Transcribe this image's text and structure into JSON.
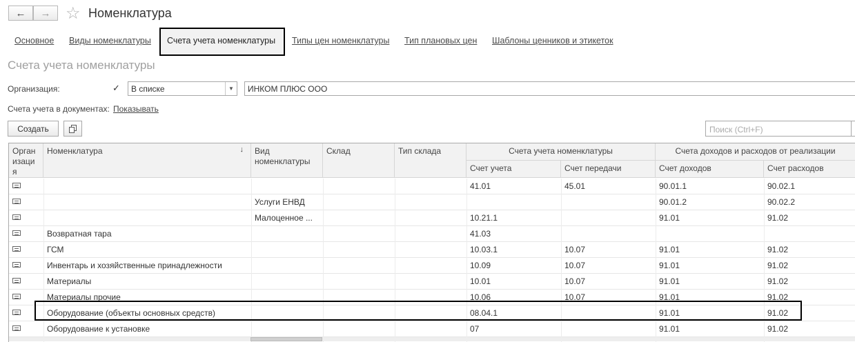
{
  "header": {
    "back_icon": "arrow-left-icon",
    "forward_icon": "arrow-right-icon",
    "favorite_icon": "star-icon",
    "title": "Номенклатура"
  },
  "tabs": [
    {
      "label": "Основное",
      "active": false
    },
    {
      "label": "Виды номенклатуры",
      "active": false
    },
    {
      "label": "Счета учета номенклатуры",
      "active": true
    },
    {
      "label": "Типы цен номенклатуры",
      "active": false
    },
    {
      "label": "Тип плановых цен",
      "active": false
    },
    {
      "label": "Шаблоны ценников и этикеток",
      "active": false
    }
  ],
  "section_title": "Счета учета номенклатуры",
  "filters": {
    "organization_label": "Организация:",
    "organization_checked": true,
    "mode_value": "В списке",
    "organization_value": "ИНКОМ ПЛЮС ООО",
    "docs_label": "Счета учета в документах:",
    "docs_link": "Показывать"
  },
  "toolbar": {
    "create_label": "Создать",
    "copy_icon": "copy-icon",
    "search_placeholder": "Поиск (Ctrl+F)"
  },
  "table": {
    "columns": {
      "org": "Орган изаци я",
      "nomenclature": "Номенклатура",
      "sort_icon": "↓",
      "kind": "Вид номенклатуры",
      "warehouse": "Склад",
      "warehouse_type": "Тип склада",
      "group_accounts": "Счета учета номенклатуры",
      "account": "Счет учета",
      "transfer_account": "Счет передачи",
      "group_income": "Счета доходов и расходов от реализации",
      "income_account": "Счет доходов",
      "expense_account": "Счет расходов"
    },
    "rows": [
      {
        "nomenclature": "",
        "kind": "",
        "account": "41.01",
        "transfer": "45.01",
        "income": "90.01.1",
        "expense": "90.02.1"
      },
      {
        "nomenclature": "",
        "kind": "Услуги ЕНВД",
        "account": "",
        "transfer": "",
        "income": "90.01.2",
        "expense": "90.02.2"
      },
      {
        "nomenclature": "",
        "kind": "Малоценное ...",
        "account": "10.21.1",
        "transfer": "",
        "income": "91.01",
        "expense": "91.02"
      },
      {
        "nomenclature": "Возвратная тара",
        "kind": "",
        "account": "41.03",
        "transfer": "",
        "income": "",
        "expense": ""
      },
      {
        "nomenclature": "ГСМ",
        "kind": "",
        "account": "10.03.1",
        "transfer": "10.07",
        "income": "91.01",
        "expense": "91.02"
      },
      {
        "nomenclature": "Инвентарь и хозяйственные принадлежности",
        "kind": "",
        "account": "10.09",
        "transfer": "10.07",
        "income": "91.01",
        "expense": "91.02"
      },
      {
        "nomenclature": "Материалы",
        "kind": "",
        "account": "10.01",
        "transfer": "10.07",
        "income": "91.01",
        "expense": "91.02"
      },
      {
        "nomenclature": "Материалы прочие",
        "kind": "",
        "account": "10.06",
        "transfer": "10.07",
        "income": "91.01",
        "expense": "91.02"
      },
      {
        "nomenclature": "Оборудование (объекты основных средств)",
        "kind": "",
        "account": "08.04.1",
        "transfer": "",
        "income": "91.01",
        "expense": "91.02"
      },
      {
        "nomenclature": "Оборудование к установке",
        "kind": "",
        "account": "07",
        "transfer": "",
        "income": "91.01",
        "expense": "91.02"
      }
    ]
  }
}
